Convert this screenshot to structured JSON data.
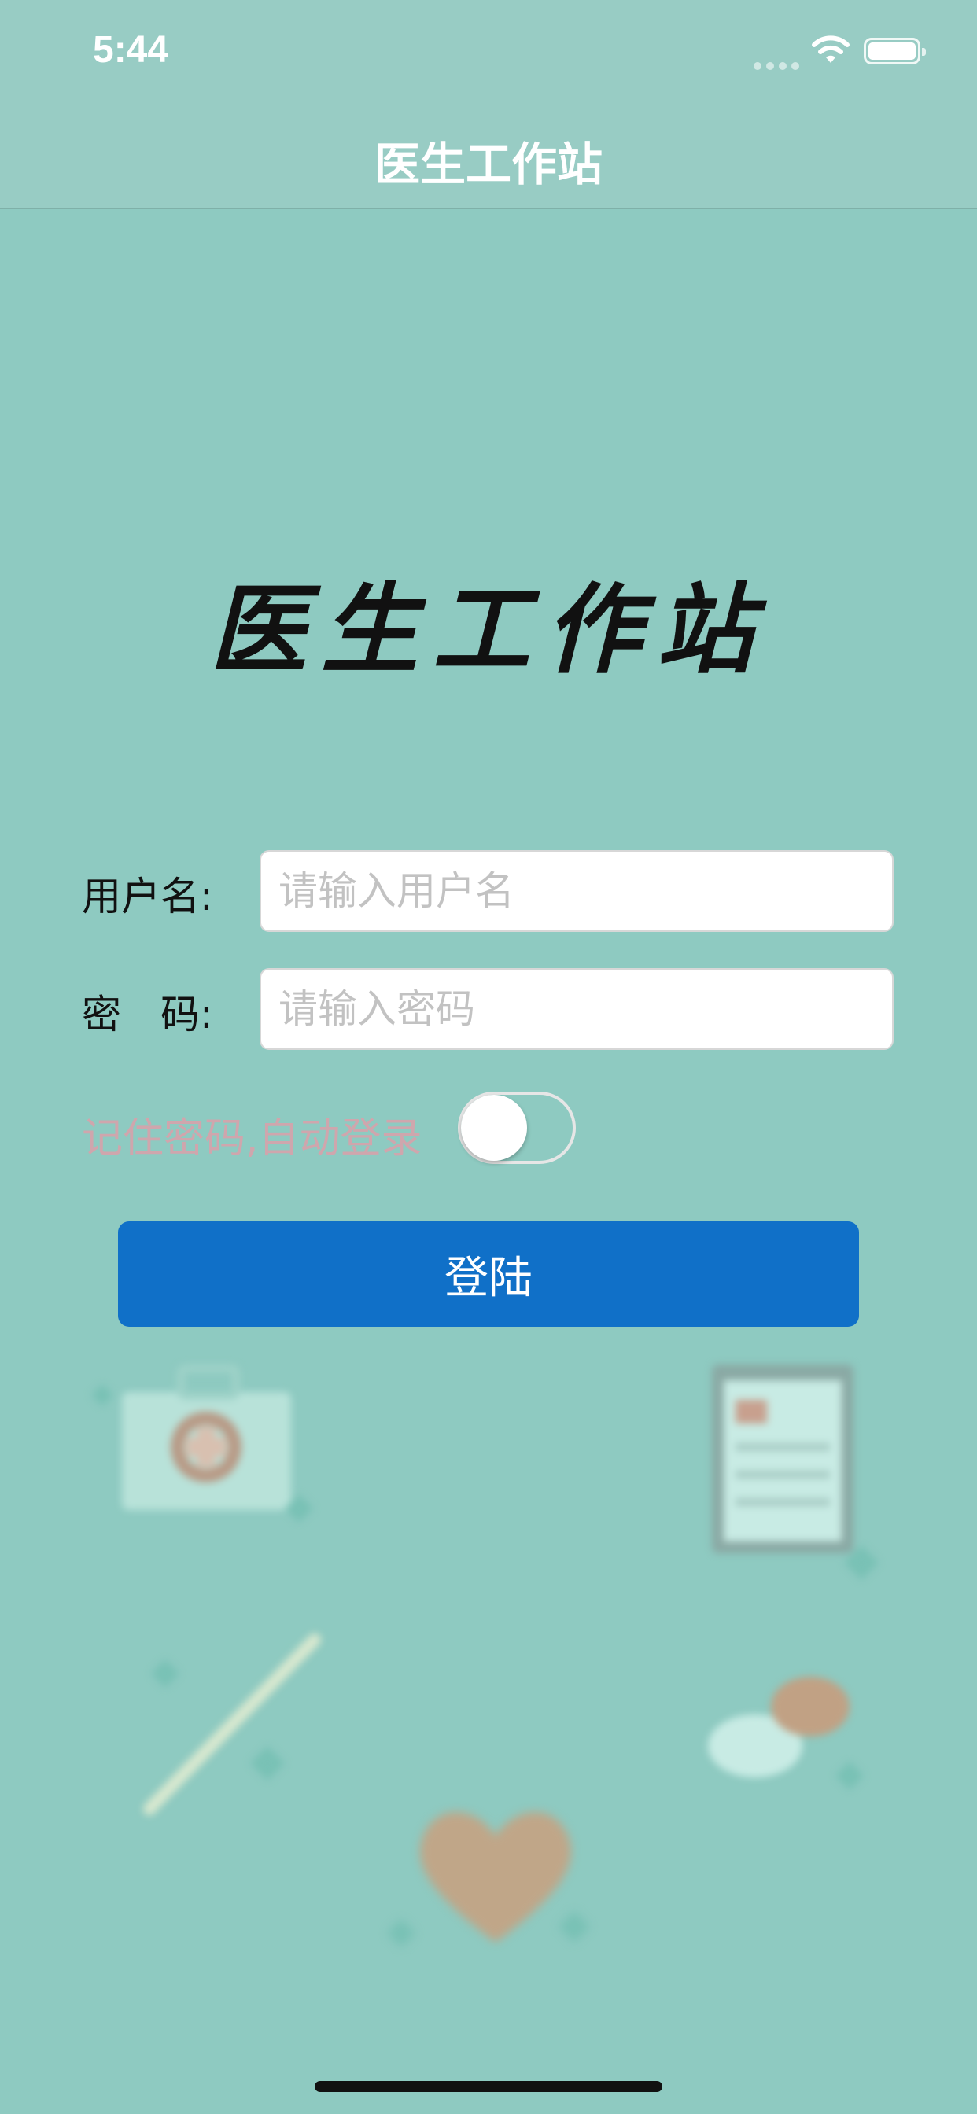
{
  "status_bar": {
    "time": "5:44"
  },
  "nav": {
    "title": "医生工作站"
  },
  "brand": {
    "title": "医生工作站"
  },
  "form": {
    "username_label": "用户名:",
    "username_placeholder": "请输入用户名",
    "password_label": "密　码:",
    "password_placeholder": "请输入密码",
    "remember_label": "记住密码,自动登录",
    "remember_enabled": false
  },
  "login_button": {
    "label": "登陆"
  },
  "colors": {
    "background": "#8ecac1",
    "button": "#1070c8",
    "remember_text": "#cfa6ad"
  },
  "icons": [
    "wifi-icon",
    "battery-icon",
    "first-aid-kit-icon",
    "clipboard-icon",
    "pen-icon",
    "pills-icon",
    "heart-icon"
  ]
}
